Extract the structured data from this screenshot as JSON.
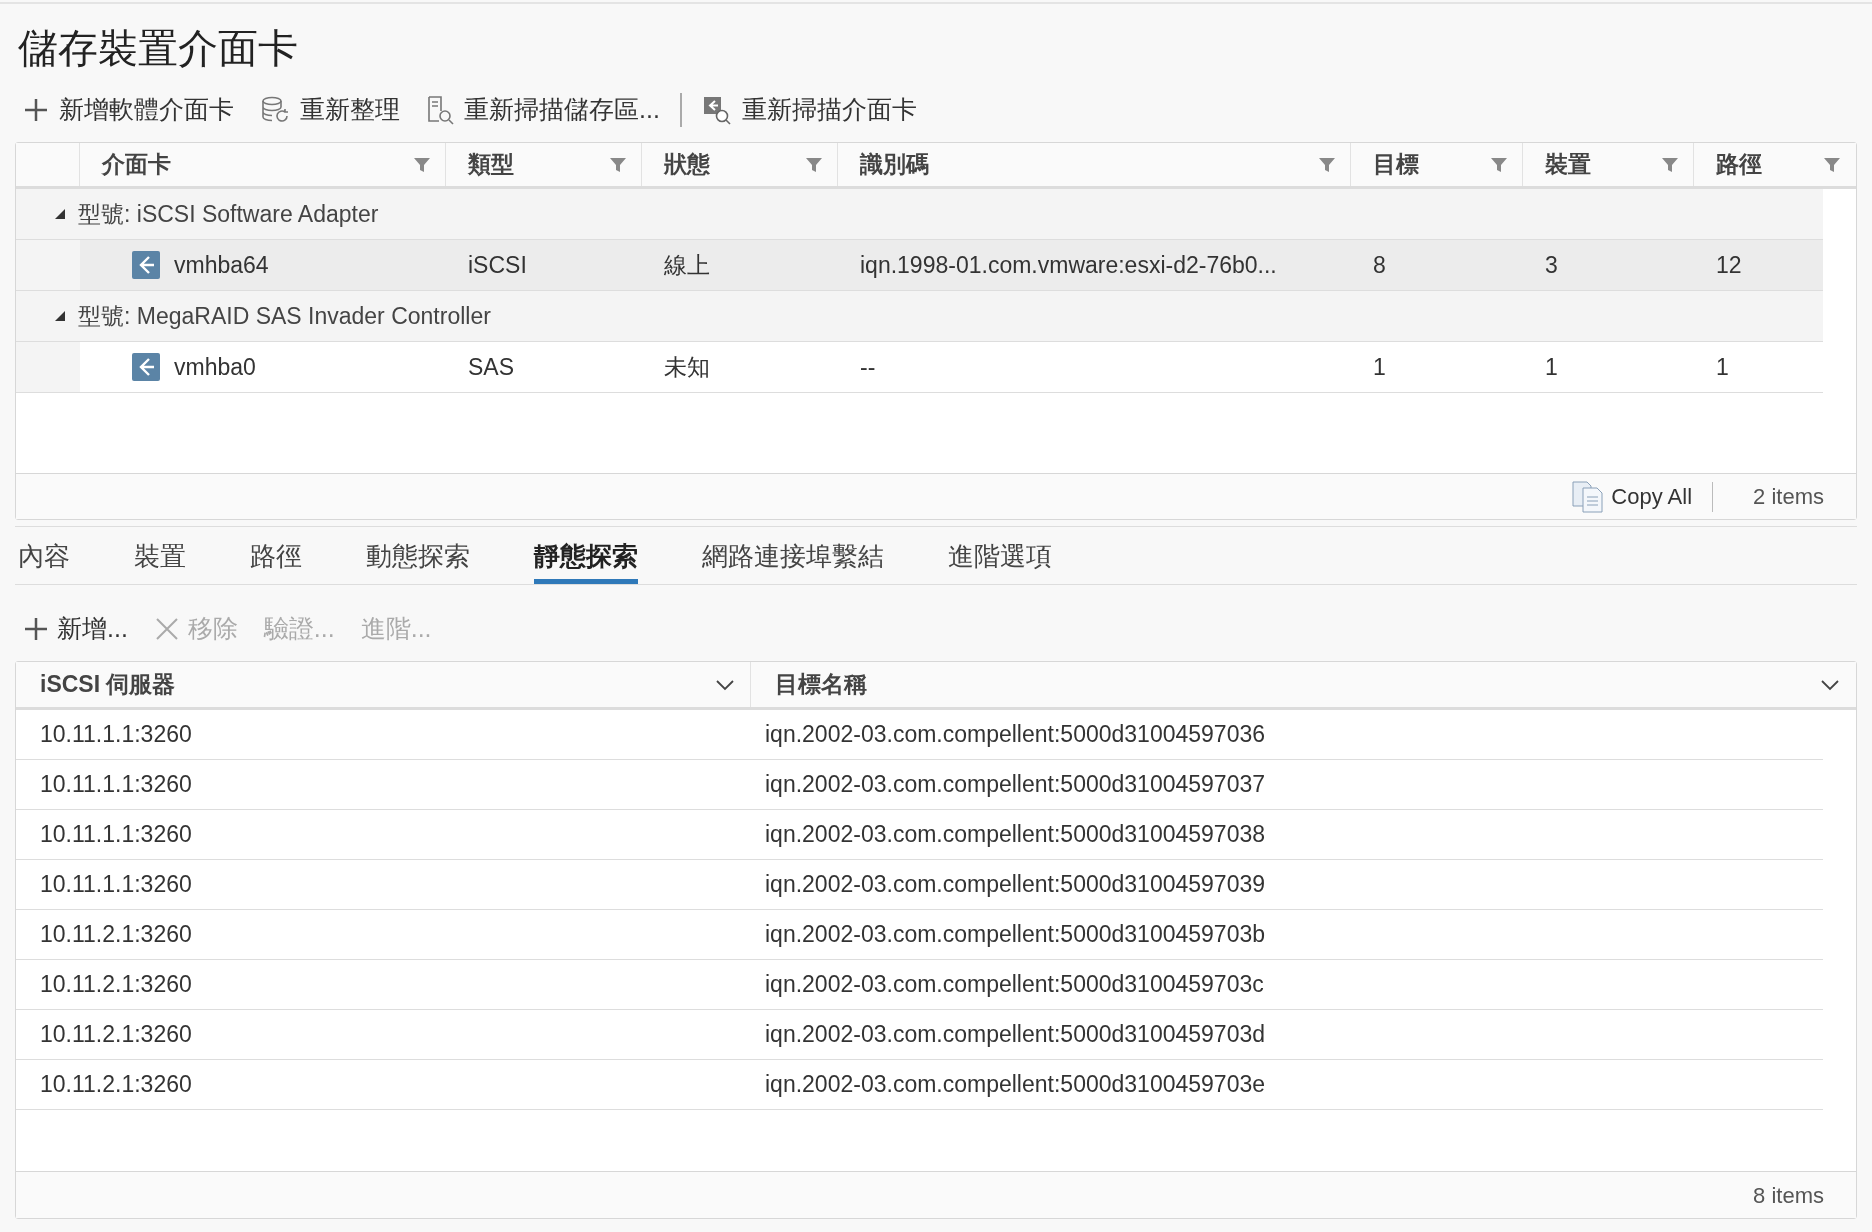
{
  "title": "儲存裝置介面卡",
  "toolbar": [
    {
      "kind": "button",
      "label": "新增軟體介面卡"
    },
    {
      "kind": "button",
      "label": "重新整理"
    },
    {
      "kind": "button",
      "label": "重新掃描儲存區..."
    },
    {
      "kind": "separator"
    },
    {
      "kind": "button",
      "label": "重新掃描介面卡"
    }
  ],
  "adapters_table": {
    "columns": [
      "介面卡",
      "類型",
      "狀態",
      "識別碼",
      "目標",
      "裝置",
      "路徑"
    ],
    "groups": [
      {
        "label": "型號: iSCSI Software Adapter",
        "expanded": true,
        "rows": [
          {
            "selected": true,
            "cells": [
              "vmhba64",
              "iSCSI",
              "線上",
              "iqn.1998-01.com.vmware:esxi-d2-76b0...",
              "8",
              "3",
              "12"
            ]
          }
        ]
      },
      {
        "label": "型號: MegaRAID SAS Invader Controller",
        "expanded": true,
        "rows": [
          {
            "selected": false,
            "cells": [
              "vmhba0",
              "SAS",
              "未知",
              "--",
              "1",
              "1",
              "1"
            ]
          }
        ]
      }
    ],
    "copy_all": "Copy All",
    "count": "2 items"
  },
  "tabs": [
    {
      "label": "內容",
      "selected": false
    },
    {
      "label": "裝置",
      "selected": false
    },
    {
      "label": "路徑",
      "selected": false
    },
    {
      "label": "動態探索",
      "selected": false
    },
    {
      "label": "靜態探索",
      "selected": true
    },
    {
      "label": "網路連接埠繫結",
      "selected": false
    },
    {
      "label": "進階選項",
      "selected": false
    }
  ],
  "actions": [
    {
      "label": "新增...",
      "disabled": false
    },
    {
      "label": "移除",
      "disabled": true
    },
    {
      "label": "驗證...",
      "disabled": true
    },
    {
      "label": "進階...",
      "disabled": true
    }
  ],
  "targets_table": {
    "columns": [
      "iSCSI 伺服器",
      "目標名稱"
    ],
    "rows": [
      [
        "10.11.1.1:3260",
        "iqn.2002-03.com.compellent:5000d31004597036"
      ],
      [
        "10.11.1.1:3260",
        "iqn.2002-03.com.compellent:5000d31004597037"
      ],
      [
        "10.11.1.1:3260",
        "iqn.2002-03.com.compellent:5000d31004597038"
      ],
      [
        "10.11.1.1:3260",
        "iqn.2002-03.com.compellent:5000d31004597039"
      ],
      [
        "10.11.2.1:3260",
        "iqn.2002-03.com.compellent:5000d3100459703b"
      ],
      [
        "10.11.2.1:3260",
        "iqn.2002-03.com.compellent:5000d3100459703c"
      ],
      [
        "10.11.2.1:3260",
        "iqn.2002-03.com.compellent:5000d3100459703d"
      ],
      [
        "10.11.2.1:3260",
        "iqn.2002-03.com.compellent:5000d3100459703e"
      ]
    ],
    "count": "8 items"
  }
}
